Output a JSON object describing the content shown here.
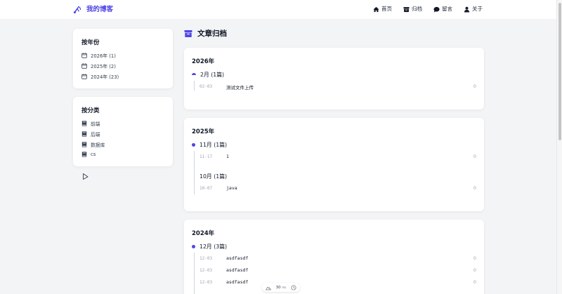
{
  "header": {
    "brand_title": "我的博客",
    "nav": [
      {
        "label": "首页",
        "icon": "home-icon"
      },
      {
        "label": "归档",
        "icon": "archive-icon"
      },
      {
        "label": "留言",
        "icon": "message-icon"
      },
      {
        "label": "关于",
        "icon": "user-icon"
      }
    ]
  },
  "sidebar": {
    "by_year": {
      "title": "按年份",
      "items": [
        {
          "label": "2026年 (1)"
        },
        {
          "label": "2025年 (2)"
        },
        {
          "label": "2024年 (23)"
        }
      ]
    },
    "by_category": {
      "title": "按分类",
      "items": [
        {
          "label": "前端"
        },
        {
          "label": "后端"
        },
        {
          "label": "数据库"
        },
        {
          "label": "cs"
        }
      ]
    }
  },
  "main": {
    "title": "文章归档",
    "years": [
      {
        "year": "2026年",
        "months": [
          {
            "label": "2月 (1篇)",
            "posts": [
              {
                "date": "02-03",
                "title": "测试文件上传",
                "count": "0"
              }
            ]
          }
        ]
      },
      {
        "year": "2025年",
        "months": [
          {
            "label": "11月 (1篇)",
            "posts": [
              {
                "date": "11-17",
                "title": "1",
                "count": "0"
              }
            ]
          },
          {
            "label": "10月 (1篇)",
            "posts": [
              {
                "date": "10-07",
                "title": "java",
                "count": "0"
              }
            ]
          }
        ]
      },
      {
        "year": "2024年",
        "months": [
          {
            "label": "12月 (3篇)",
            "posts": [
              {
                "date": "12-03",
                "title": "asdfasdf",
                "count": "0"
              },
              {
                "date": "12-03",
                "title": "asdfasdf",
                "count": "0"
              },
              {
                "date": "12-03",
                "title": "asdfasdf",
                "count": "0"
              }
            ]
          }
        ]
      }
    ]
  },
  "widget": {
    "value": "30",
    "unit": "ms"
  },
  "colors": {
    "accent": "#4f46e5",
    "background": "#f3f4f6",
    "card": "#ffffff"
  }
}
